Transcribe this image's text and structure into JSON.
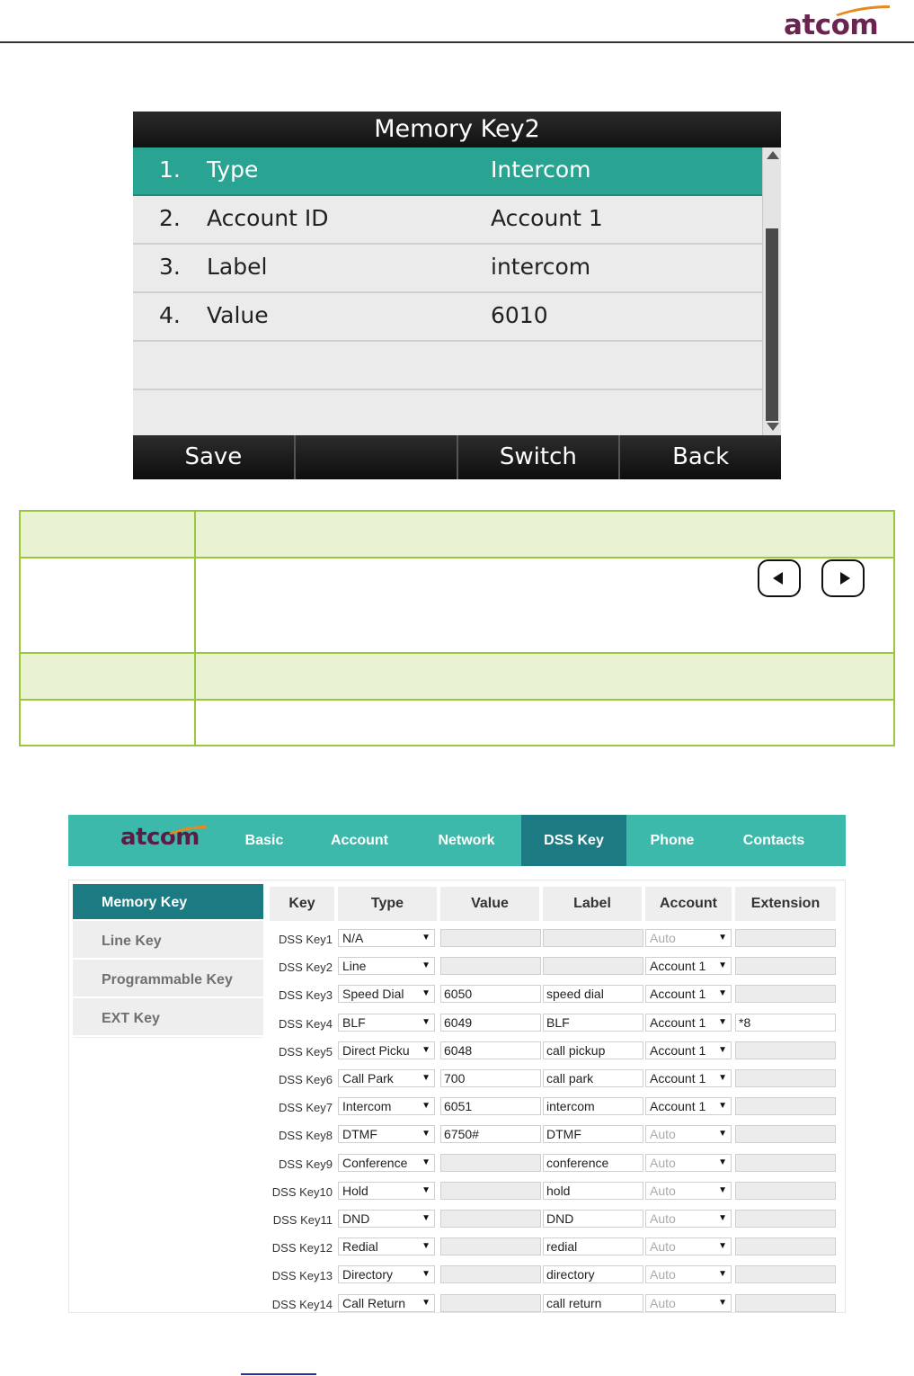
{
  "brand": {
    "doc_logo": "atcom",
    "web_logo": "atcom",
    "logo_color": "#6b2350",
    "accent": "#3cb9aa",
    "active": "#1b7a82"
  },
  "phone": {
    "title": "Memory Key2",
    "rows": [
      {
        "num": "1.",
        "name": "Type",
        "value": "Intercom"
      },
      {
        "num": "2.",
        "name": "Account ID",
        "value": "Account 1"
      },
      {
        "num": "3.",
        "name": "Label",
        "value": "intercom"
      },
      {
        "num": "4.",
        "name": "Value",
        "value": "6010"
      }
    ],
    "softkeys": [
      "Save",
      "",
      "Switch",
      "Back"
    ]
  },
  "nav_buttons": {
    "left_icon": "left-arrow-key-icon",
    "right_icon": "right-arrow-key-icon"
  },
  "web": {
    "tabs": [
      "Basic",
      "Account",
      "Network",
      "DSS Key",
      "Phone",
      "Contacts"
    ],
    "sidebar": [
      "Memory Key",
      "Line Key",
      "Programmable Key",
      "EXT Key"
    ],
    "columns": [
      "Key",
      "Type",
      "Value",
      "Label",
      "Account",
      "Extension"
    ],
    "rows": [
      {
        "key": "DSS Key1",
        "type": "N/A",
        "value": "",
        "label": "",
        "account": "Auto",
        "extension": ""
      },
      {
        "key": "DSS Key2",
        "type": "Line",
        "value": "",
        "label": "",
        "account": "Account 1",
        "extension": ""
      },
      {
        "key": "DSS Key3",
        "type": "Speed Dial",
        "value": "6050",
        "label": "speed dial",
        "account": "Account 1",
        "extension": ""
      },
      {
        "key": "DSS Key4",
        "type": "BLF",
        "value": "6049",
        "label": "BLF",
        "account": "Account 1",
        "extension": "*8"
      },
      {
        "key": "DSS Key5",
        "type": "Direct Picku",
        "value": "6048",
        "label": "call pickup",
        "account": "Account 1",
        "extension": ""
      },
      {
        "key": "DSS Key6",
        "type": "Call Park",
        "value": "700",
        "label": "call park",
        "account": "Account 1",
        "extension": ""
      },
      {
        "key": "DSS Key7",
        "type": "Intercom",
        "value": "6051",
        "label": "intercom",
        "account": "Account 1",
        "extension": ""
      },
      {
        "key": "DSS Key8",
        "type": "DTMF",
        "value": "6750#",
        "label": "DTMF",
        "account": "Auto",
        "extension": ""
      },
      {
        "key": "DSS Key9",
        "type": "Conference",
        "value": "",
        "label": "conference",
        "account": "Auto",
        "extension": ""
      },
      {
        "key": "DSS Key10",
        "type": "Hold",
        "value": "",
        "label": "hold",
        "account": "Auto",
        "extension": ""
      },
      {
        "key": "DSS Key11",
        "type": "DND",
        "value": "",
        "label": "DND",
        "account": "Auto",
        "extension": ""
      },
      {
        "key": "DSS Key12",
        "type": "Redial",
        "value": "",
        "label": "redial",
        "account": "Auto",
        "extension": ""
      },
      {
        "key": "DSS Key13",
        "type": "Directory",
        "value": "",
        "label": "directory",
        "account": "Auto",
        "extension": ""
      },
      {
        "key": "DSS Key14",
        "type": "Call Return",
        "value": "",
        "label": "call return",
        "account": "Auto",
        "extension": ""
      }
    ]
  }
}
